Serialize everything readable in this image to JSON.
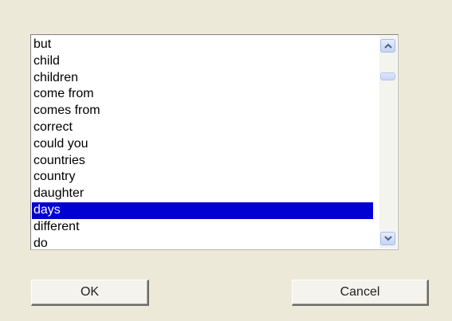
{
  "dialog": {
    "list": {
      "items": [
        "but",
        "child",
        "children",
        "come from",
        "comes from",
        "correct",
        "could you",
        "countries",
        "country",
        "daughter",
        "days",
        "different",
        "do"
      ],
      "selected_item": "days"
    },
    "buttons": {
      "ok_label": "OK",
      "cancel_label": "Cancel"
    }
  },
  "colors": {
    "background": "#ece9d8",
    "selection": "#0000d4",
    "scrollbar_accent": "#c3d3f5"
  }
}
